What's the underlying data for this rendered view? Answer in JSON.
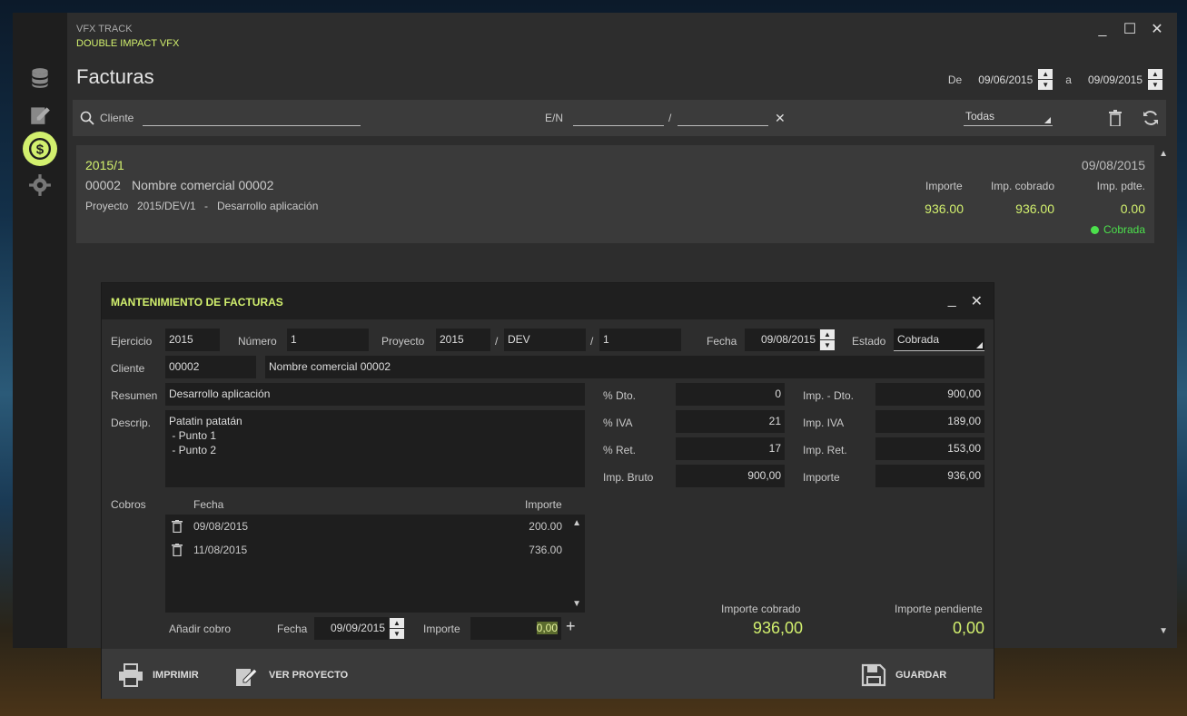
{
  "app": {
    "title": "VFX TRACK",
    "company": "DOUBLE IMPACT VFX"
  },
  "window_controls": {
    "minimize": "_",
    "maximize": "☐",
    "close": "✕"
  },
  "sidebar": {
    "items": [
      {
        "icon": "database-icon",
        "active": false
      },
      {
        "icon": "edit-document-icon",
        "active": false
      },
      {
        "icon": "dollar-icon",
        "active": true
      },
      {
        "icon": "gear-icon",
        "active": false
      }
    ]
  },
  "page": {
    "title": "Facturas"
  },
  "date_range": {
    "from_label": "De",
    "from": "09/06/2015",
    "to_label": "a",
    "to": "09/09/2015"
  },
  "filter": {
    "client_placeholder": "Cliente",
    "en_label": "E/N",
    "separator": "/",
    "clear": "✕",
    "status": "Todas"
  },
  "invoice_card": {
    "number": "2015/1",
    "date": "09/08/2015",
    "client_code": "00002",
    "client_name": "Nombre comercial 00002",
    "project_label": "Proyecto",
    "project": "2015/DEV/1",
    "dash": "-",
    "project_desc": "Desarrollo aplicación",
    "cols": [
      {
        "label": "Importe",
        "value": "936.00"
      },
      {
        "label": "Imp. cobrado",
        "value": "936.00"
      },
      {
        "label": "Imp. pdte.",
        "value": "0.00"
      }
    ],
    "status": "Cobrada"
  },
  "dialog": {
    "title": "MANTENIMIENTO DE FACTURAS",
    "minimize": "_",
    "close": "✕",
    "ejercicio_label": "Ejercicio",
    "ejercicio": "2015",
    "numero_label": "Número",
    "numero": "1",
    "proyecto_label": "Proyecto",
    "proyecto_year": "2015",
    "proyecto_code": "DEV",
    "proyecto_num": "1",
    "slash": "/",
    "fecha_label": "Fecha",
    "fecha": "09/08/2015",
    "estado_label": "Estado",
    "estado": "Cobrada",
    "cliente_label": "Cliente",
    "cliente_code": "00002",
    "cliente_name": "Nombre comercial 00002",
    "resumen_label": "Resumen",
    "resumen": "Desarrollo aplicación",
    "descrip_label": "Descrip.",
    "descrip": "Patatin patatán\n - Punto 1\n - Punto 2",
    "dto_label": "% Dto.",
    "dto": "0",
    "iva_label": "% IVA",
    "iva": "21",
    "ret_label": "% Ret.",
    "ret": "17",
    "bruto_label": "Imp. Bruto",
    "bruto": "900,00",
    "imp_dto_label": "Imp. - Dto.",
    "imp_dto": "900,00",
    "imp_iva_label": "Imp. IVA",
    "imp_iva": "189,00",
    "imp_ret_label": "Imp. Ret.",
    "imp_ret": "153,00",
    "importe_label": "Importe",
    "importe": "936,00",
    "cobros_label": "Cobros",
    "cobros_col_fecha": "Fecha",
    "cobros_col_importe": "Importe",
    "cobros": [
      {
        "fecha": "09/08/2015",
        "importe": "200.00"
      },
      {
        "fecha": "11/08/2015",
        "importe": "736.00"
      }
    ],
    "anadir_label": "Añadir cobro",
    "anadir_fecha_label": "Fecha",
    "anadir_fecha": "09/09/2015",
    "anadir_importe_label": "Importe",
    "anadir_importe": "0,00",
    "add": "+",
    "cobrado_label": "Importe cobrado",
    "cobrado": "936,00",
    "pendiente_label": "Importe pendiente",
    "pendiente": "0,00",
    "btn_imprimir": "IMPRIMIR",
    "btn_ver_proyecto": "VER PROYECTO",
    "btn_guardar": "GUARDAR"
  },
  "colors": {
    "accent": "#d2f06e",
    "status_green": "#4ce04c",
    "panel": "#2d2d2d",
    "sidebar": "#1e1e1e"
  }
}
